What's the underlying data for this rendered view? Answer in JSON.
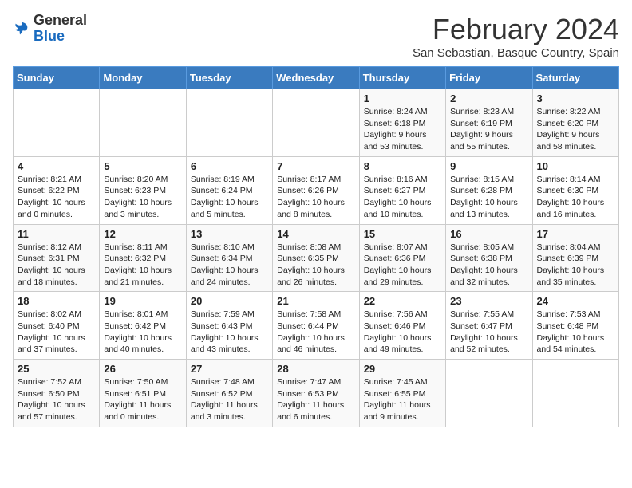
{
  "header": {
    "logo_general": "General",
    "logo_blue": "Blue",
    "month_title": "February 2024",
    "subtitle": "San Sebastian, Basque Country, Spain"
  },
  "days_of_week": [
    "Sunday",
    "Monday",
    "Tuesday",
    "Wednesday",
    "Thursday",
    "Friday",
    "Saturday"
  ],
  "weeks": [
    [
      null,
      null,
      null,
      null,
      {
        "day": "1",
        "sunrise": "8:24 AM",
        "sunset": "6:18 PM",
        "daylight": "9 hours and 53 minutes."
      },
      {
        "day": "2",
        "sunrise": "8:23 AM",
        "sunset": "6:19 PM",
        "daylight": "9 hours and 55 minutes."
      },
      {
        "day": "3",
        "sunrise": "8:22 AM",
        "sunset": "6:20 PM",
        "daylight": "9 hours and 58 minutes."
      }
    ],
    [
      {
        "day": "4",
        "sunrise": "8:21 AM",
        "sunset": "6:22 PM",
        "daylight": "10 hours and 0 minutes."
      },
      {
        "day": "5",
        "sunrise": "8:20 AM",
        "sunset": "6:23 PM",
        "daylight": "10 hours and 3 minutes."
      },
      {
        "day": "6",
        "sunrise": "8:19 AM",
        "sunset": "6:24 PM",
        "daylight": "10 hours and 5 minutes."
      },
      {
        "day": "7",
        "sunrise": "8:17 AM",
        "sunset": "6:26 PM",
        "daylight": "10 hours and 8 minutes."
      },
      {
        "day": "8",
        "sunrise": "8:16 AM",
        "sunset": "6:27 PM",
        "daylight": "10 hours and 10 minutes."
      },
      {
        "day": "9",
        "sunrise": "8:15 AM",
        "sunset": "6:28 PM",
        "daylight": "10 hours and 13 minutes."
      },
      {
        "day": "10",
        "sunrise": "8:14 AM",
        "sunset": "6:30 PM",
        "daylight": "10 hours and 16 minutes."
      }
    ],
    [
      {
        "day": "11",
        "sunrise": "8:12 AM",
        "sunset": "6:31 PM",
        "daylight": "10 hours and 18 minutes."
      },
      {
        "day": "12",
        "sunrise": "8:11 AM",
        "sunset": "6:32 PM",
        "daylight": "10 hours and 21 minutes."
      },
      {
        "day": "13",
        "sunrise": "8:10 AM",
        "sunset": "6:34 PM",
        "daylight": "10 hours and 24 minutes."
      },
      {
        "day": "14",
        "sunrise": "8:08 AM",
        "sunset": "6:35 PM",
        "daylight": "10 hours and 26 minutes."
      },
      {
        "day": "15",
        "sunrise": "8:07 AM",
        "sunset": "6:36 PM",
        "daylight": "10 hours and 29 minutes."
      },
      {
        "day": "16",
        "sunrise": "8:05 AM",
        "sunset": "6:38 PM",
        "daylight": "10 hours and 32 minutes."
      },
      {
        "day": "17",
        "sunrise": "8:04 AM",
        "sunset": "6:39 PM",
        "daylight": "10 hours and 35 minutes."
      }
    ],
    [
      {
        "day": "18",
        "sunrise": "8:02 AM",
        "sunset": "6:40 PM",
        "daylight": "10 hours and 37 minutes."
      },
      {
        "day": "19",
        "sunrise": "8:01 AM",
        "sunset": "6:42 PM",
        "daylight": "10 hours and 40 minutes."
      },
      {
        "day": "20",
        "sunrise": "7:59 AM",
        "sunset": "6:43 PM",
        "daylight": "10 hours and 43 minutes."
      },
      {
        "day": "21",
        "sunrise": "7:58 AM",
        "sunset": "6:44 PM",
        "daylight": "10 hours and 46 minutes."
      },
      {
        "day": "22",
        "sunrise": "7:56 AM",
        "sunset": "6:46 PM",
        "daylight": "10 hours and 49 minutes."
      },
      {
        "day": "23",
        "sunrise": "7:55 AM",
        "sunset": "6:47 PM",
        "daylight": "10 hours and 52 minutes."
      },
      {
        "day": "24",
        "sunrise": "7:53 AM",
        "sunset": "6:48 PM",
        "daylight": "10 hours and 54 minutes."
      }
    ],
    [
      {
        "day": "25",
        "sunrise": "7:52 AM",
        "sunset": "6:50 PM",
        "daylight": "10 hours and 57 minutes."
      },
      {
        "day": "26",
        "sunrise": "7:50 AM",
        "sunset": "6:51 PM",
        "daylight": "11 hours and 0 minutes."
      },
      {
        "day": "27",
        "sunrise": "7:48 AM",
        "sunset": "6:52 PM",
        "daylight": "11 hours and 3 minutes."
      },
      {
        "day": "28",
        "sunrise": "7:47 AM",
        "sunset": "6:53 PM",
        "daylight": "11 hours and 6 minutes."
      },
      {
        "day": "29",
        "sunrise": "7:45 AM",
        "sunset": "6:55 PM",
        "daylight": "11 hours and 9 minutes."
      },
      null,
      null
    ]
  ]
}
